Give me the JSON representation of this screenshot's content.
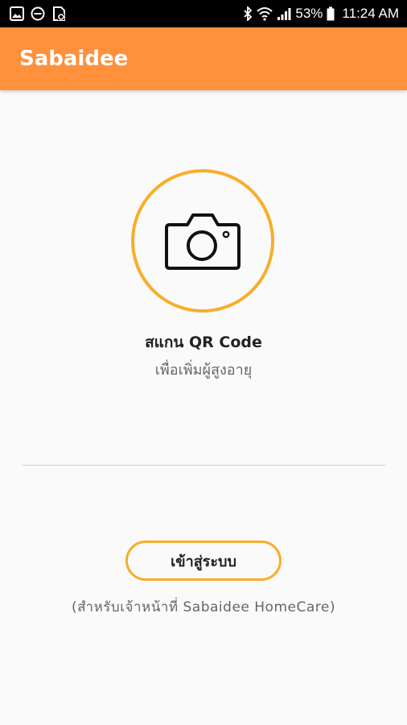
{
  "status_bar": {
    "battery": "53%",
    "time": "11:24 AM",
    "icons": [
      "image-icon",
      "do-not-disturb-icon",
      "sim-icon",
      "bluetooth-icon",
      "wifi-icon",
      "signal-icon",
      "battery-icon"
    ]
  },
  "app_bar": {
    "title": "Sabaidee",
    "color": "#ff913d"
  },
  "scan": {
    "icon": "camera-icon",
    "title": "สแกน QR Code",
    "subtitle": "เพื่อเพิ่มผู้สูงอายุ",
    "accent": "#f7ae2a"
  },
  "login": {
    "button_label": "เข้าสู่ระบบ",
    "note": "(สำหรับเจ้าหน้าที่ Sabaidee HomeCare)"
  }
}
